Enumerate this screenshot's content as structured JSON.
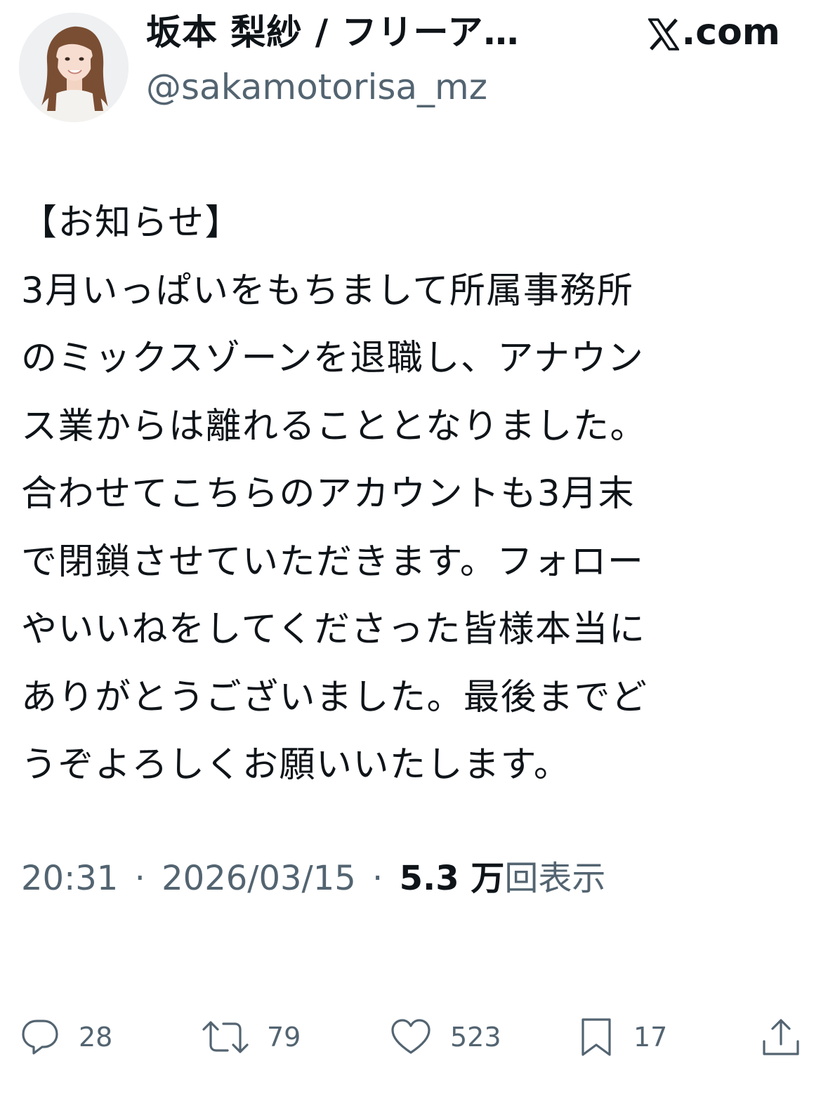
{
  "header": {
    "display_name": "坂本 梨紗 / フリーア…",
    "handle": "@sakamotorisa_mz",
    "source_label": ".com",
    "source_logo_icon": "x-logo-icon"
  },
  "tweet": {
    "lines": [
      "【お知らせ】",
      "3月いっぱいをもちまして所属事務所",
      "のミックスゾーンを退職し、アナウン",
      "ス業からは離れることとなりました。",
      "合わせてこちらのアカウントも3月末",
      "で閉鎖させていただきます。フォロー",
      "やいいねをしてくださった皆様本当に",
      "ありがとうございました。最後までど",
      "うぞよろしくお願いいたします。"
    ]
  },
  "meta": {
    "time": "20:31",
    "separator": "·",
    "date": "2026/03/15",
    "views_count": "5.3 万",
    "views_label": "回表示"
  },
  "actions": {
    "reply": {
      "icon": "reply-icon",
      "count": "28"
    },
    "retweet": {
      "icon": "retweet-icon",
      "count": "79"
    },
    "like": {
      "icon": "heart-icon",
      "count": "523"
    },
    "bookmark": {
      "icon": "bookmark-icon",
      "count": "17"
    },
    "share": {
      "icon": "share-icon"
    }
  },
  "colors": {
    "text_primary": "#0f1419",
    "text_secondary": "#536471",
    "background": "#ffffff"
  }
}
